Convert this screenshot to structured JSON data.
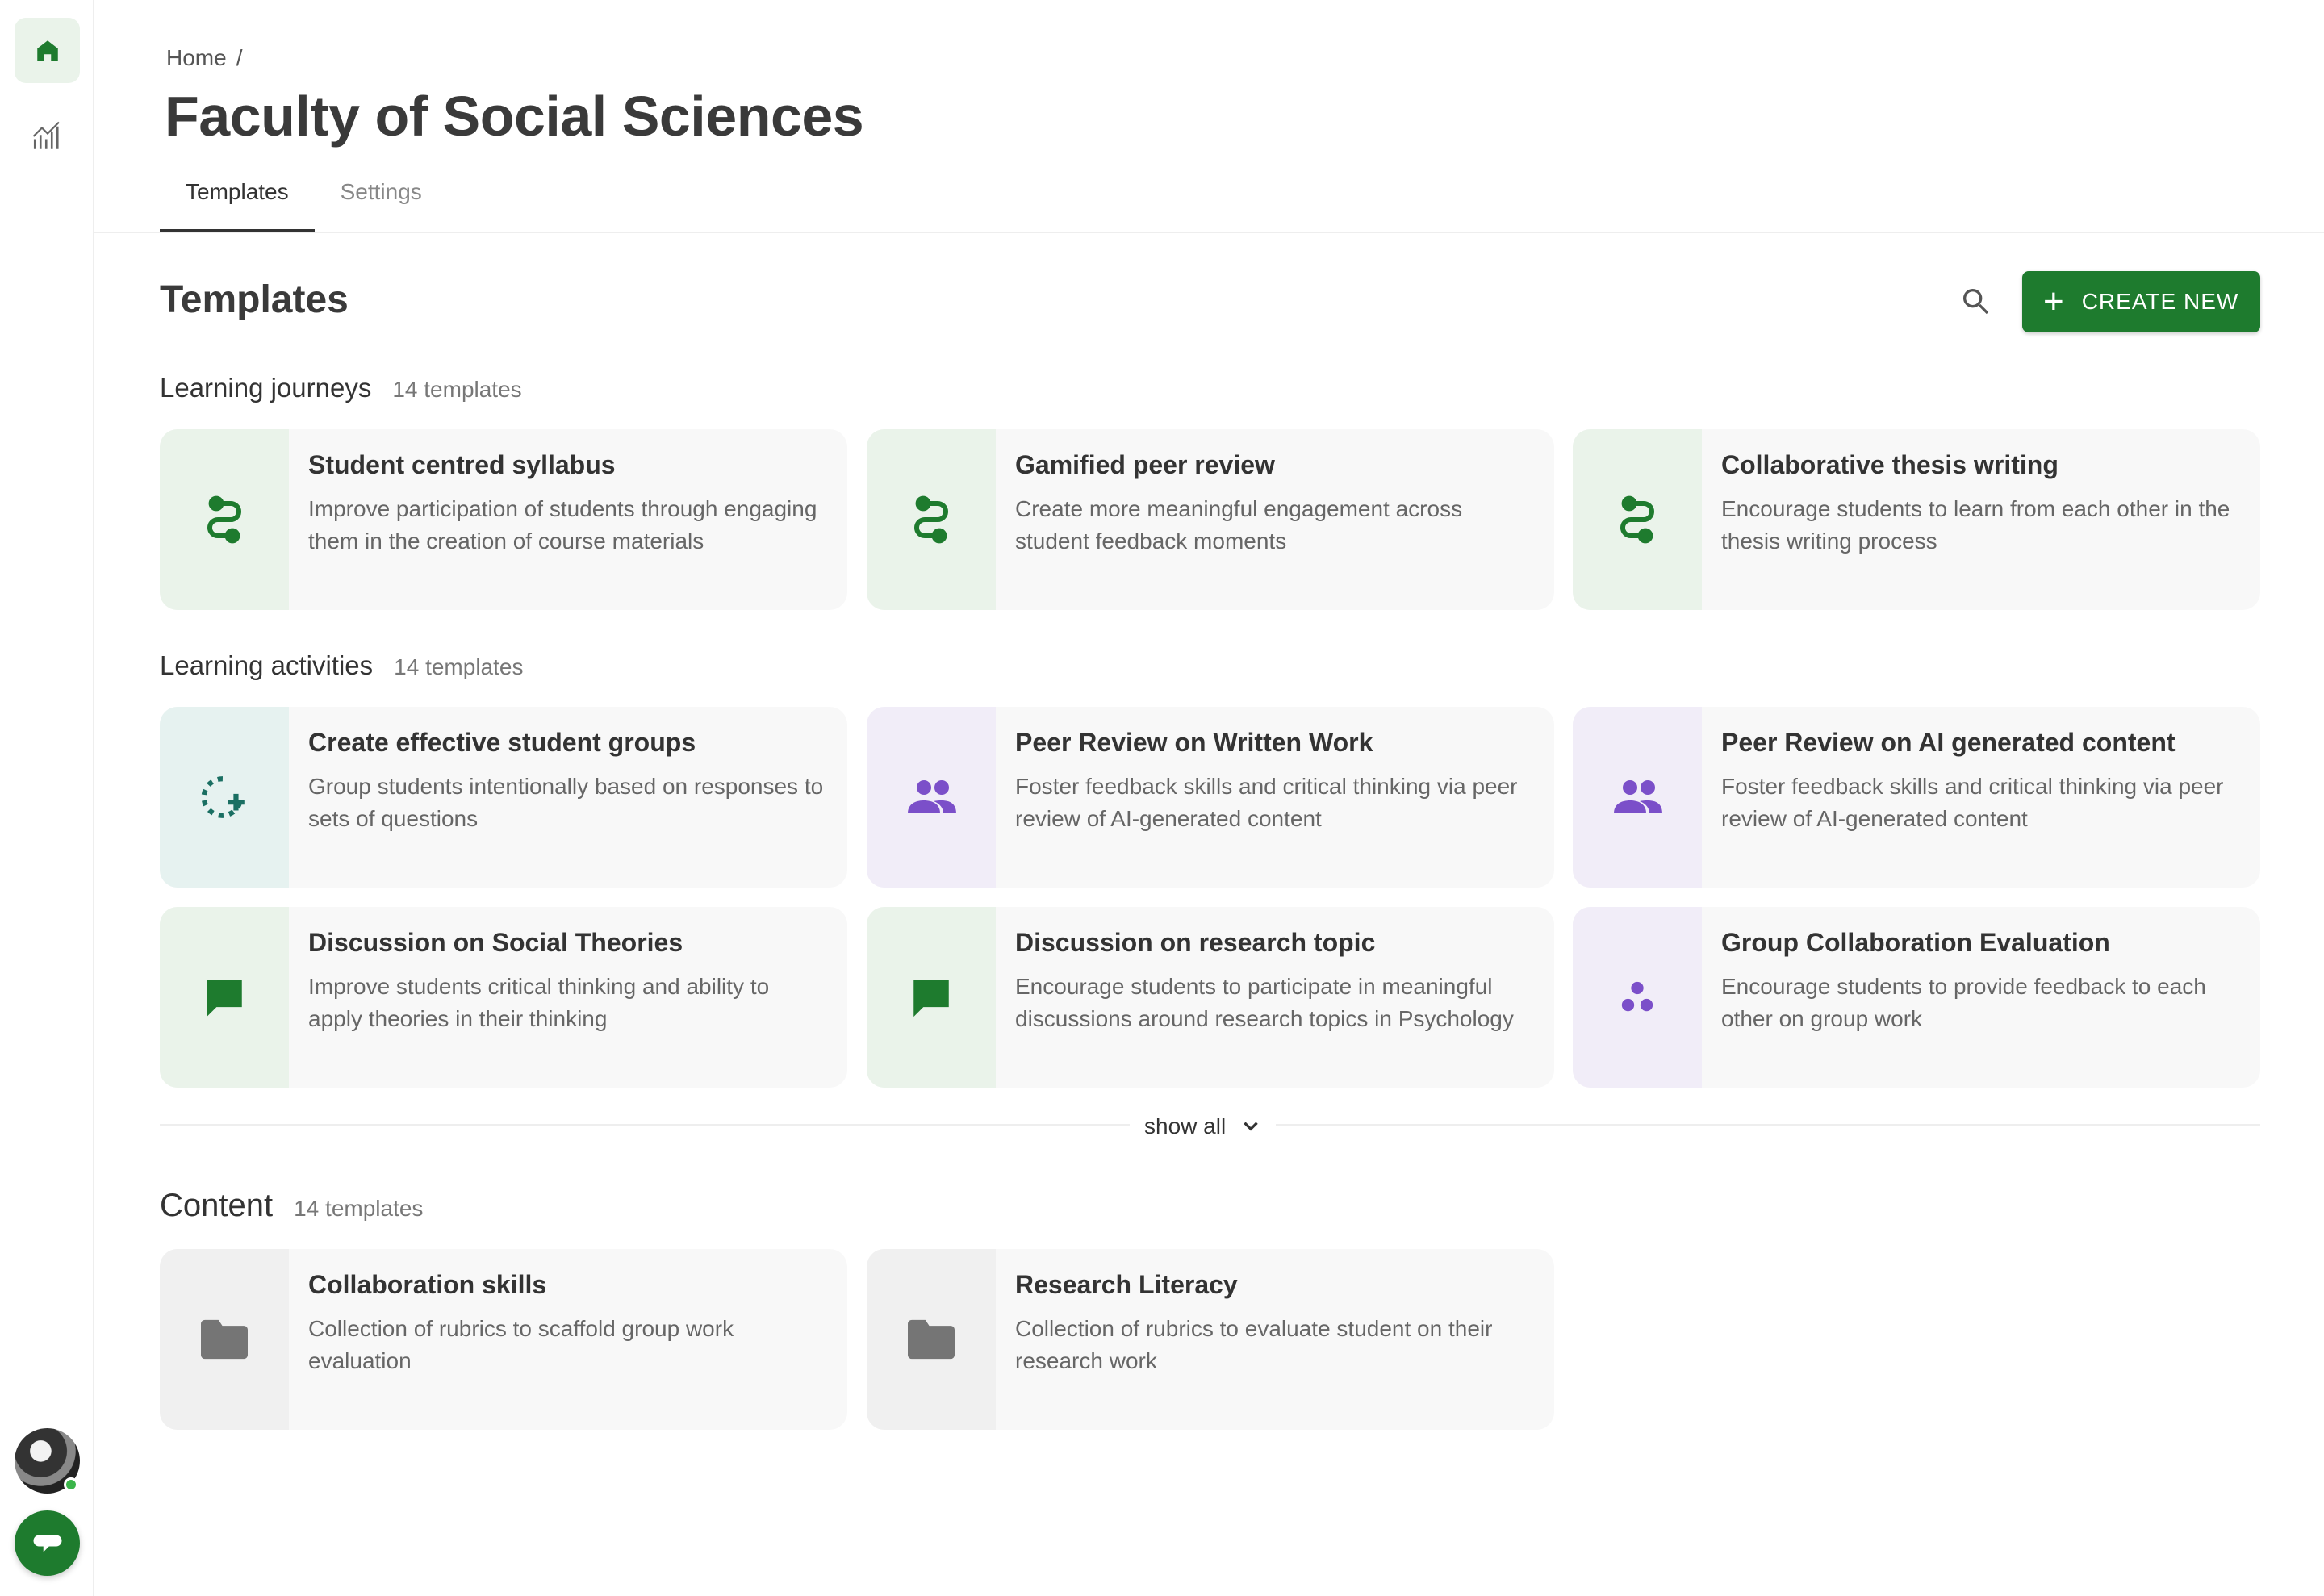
{
  "breadcrumb": {
    "home": "Home",
    "separator": "/"
  },
  "page": {
    "title": "Faculty of Social Sciences"
  },
  "tabs": [
    {
      "label": "Templates",
      "active": true
    },
    {
      "label": "Settings",
      "active": false
    }
  ],
  "templates": {
    "title": "Templates",
    "create_label": "CREATE NEW"
  },
  "groups": {
    "journeys": {
      "name": "Learning journeys",
      "count": "14 templates",
      "cards": [
        {
          "title": "Student centred syllabus",
          "desc": "Improve participation of students through engaging them in the creation of course materials",
          "icon": "route-icon"
        },
        {
          "title": "Gamified peer review",
          "desc": "Create more meaningful engagement across student feedback moments",
          "icon": "route-icon"
        },
        {
          "title": "Collaborative thesis writing",
          "desc": "Encourage students to learn from each other in the thesis writing process",
          "icon": "route-icon"
        }
      ]
    },
    "activities": {
      "name": "Learning activities",
      "count": "14 templates",
      "cards": [
        {
          "title": "Create effective student groups",
          "desc": "Group students intentionally based on responses to sets of questions",
          "icon": "group-add-icon"
        },
        {
          "title": "Peer Review on Written Work",
          "desc": "Foster feedback skills and critical thinking via peer review of AI-generated content",
          "icon": "people-icon"
        },
        {
          "title": "Peer Review on AI generated content",
          "desc": "Foster feedback skills and critical thinking via peer review of AI-generated content",
          "icon": "people-icon"
        },
        {
          "title": "Discussion on Social Theories",
          "desc": "Improve students critical thinking and ability to apply theories in their thinking",
          "icon": "chat-bubble-icon"
        },
        {
          "title": "Discussion on research topic",
          "desc": "Encourage students to participate in meaningful discussions around research topics in Psychology",
          "icon": "chat-bubble-icon"
        },
        {
          "title": "Group Collaboration Evaluation",
          "desc": "Encourage students to provide feedback to each other on group work",
          "icon": "workspaces-icon"
        }
      ],
      "show_all": "show all"
    },
    "content": {
      "name": "Content",
      "count": "14 templates",
      "cards": [
        {
          "title": "Collaboration skills",
          "desc": "Collection of rubrics to scaffold group work evaluation",
          "icon": "folder-icon"
        },
        {
          "title": "Research Literacy",
          "desc": "Collection of rubrics to evaluate student on their research work",
          "icon": "folder-icon"
        }
      ]
    }
  },
  "colors": {
    "brand_green": "#1e7b2e",
    "purple_icon": "#7b4fc9",
    "grey_icon": "#757575",
    "teal_icon": "#1a6f62"
  }
}
